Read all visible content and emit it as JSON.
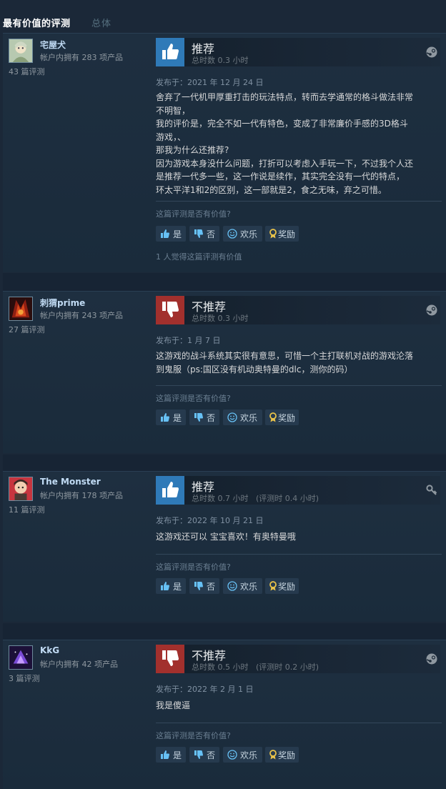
{
  "header": {
    "title": "最有价值的评测",
    "subtitle": "总体"
  },
  "labels": {
    "posted_prefix": "发布于：",
    "helpful_question": "这篇评测是否有价值?",
    "yes": "是",
    "no": "否",
    "funny": "欢乐",
    "award": "奖励"
  },
  "reviews": [
    {
      "username": "宅屋犬",
      "owned": "帐户内拥有 283 项产品",
      "review_count": "43 篇评测",
      "verdict": "推荐",
      "recommended": true,
      "hours": "总时数 0.3 小时",
      "posted": "发布于：2021 年 12 月 24 日",
      "content_lines": [
        "舍弃了一代机甲厚重打击的玩法特点，转而去学通常的格斗做法非常",
        "不明智，",
        "我的评价是，完全不如一代有特色，变成了非常廉价手感的3D格斗",
        "游戏，、",
        "那我为什么还推荐?",
        "因为游戏本身没什么问题，打折可以考虑入手玩一下，不过我个人还",
        "是推荐一代多一些，这一作说是续作，其实完全没有一代的特点，",
        "环太平洋1和2的区别，这一部就是2，食之无味，弃之可惜。"
      ],
      "found_helpful": "1 人觉得这篇评测有价值",
      "source_icon": "steam-icon"
    },
    {
      "username": "刺猬prime",
      "owned": "帐户内拥有 243 项产品",
      "review_count": "27 篇评测",
      "verdict": "不推荐",
      "recommended": false,
      "hours": "总时数 0.3 小时",
      "posted": "发布于：1 月 7 日",
      "content_lines": [
        "这游戏的战斗系统其实很有意思，可惜一个主打联机对战的游戏沦落",
        "到鬼服（ps:国区没有机动奥特曼的dlc，测你的码）"
      ],
      "found_helpful": "",
      "source_icon": "steam-icon"
    },
    {
      "username": "The Monster",
      "owned": "帐户内拥有 178 项产品",
      "review_count": "11 篇评测",
      "verdict": "推荐",
      "recommended": true,
      "hours": "总时数 0.7 小时   (评测时 0.4 小时)",
      "posted": "发布于：2022 年 10 月 21 日",
      "content_lines": [
        "这游戏还可以 宝宝喜欢！有奥特曼哦"
      ],
      "found_helpful": "",
      "source_icon": "key-icon"
    },
    {
      "username": "KkG",
      "owned": "帐户内拥有 42 项产品",
      "review_count": "3 篇评测",
      "verdict": "不推荐",
      "recommended": false,
      "hours": "总时数 0.5 小时   (评测时 0.2 小时)",
      "posted": "发布于：2022 年 2 月 1 日",
      "content_lines": [
        "我是傻逼"
      ],
      "found_helpful": "",
      "source_icon": "steam-icon"
    }
  ],
  "colors": {
    "background": "#1b2838",
    "thumb_up": "#2f7ab8",
    "thumb_down": "#a2302d",
    "username": "#c1dbf4",
    "award_gold": "#e8c24a"
  }
}
